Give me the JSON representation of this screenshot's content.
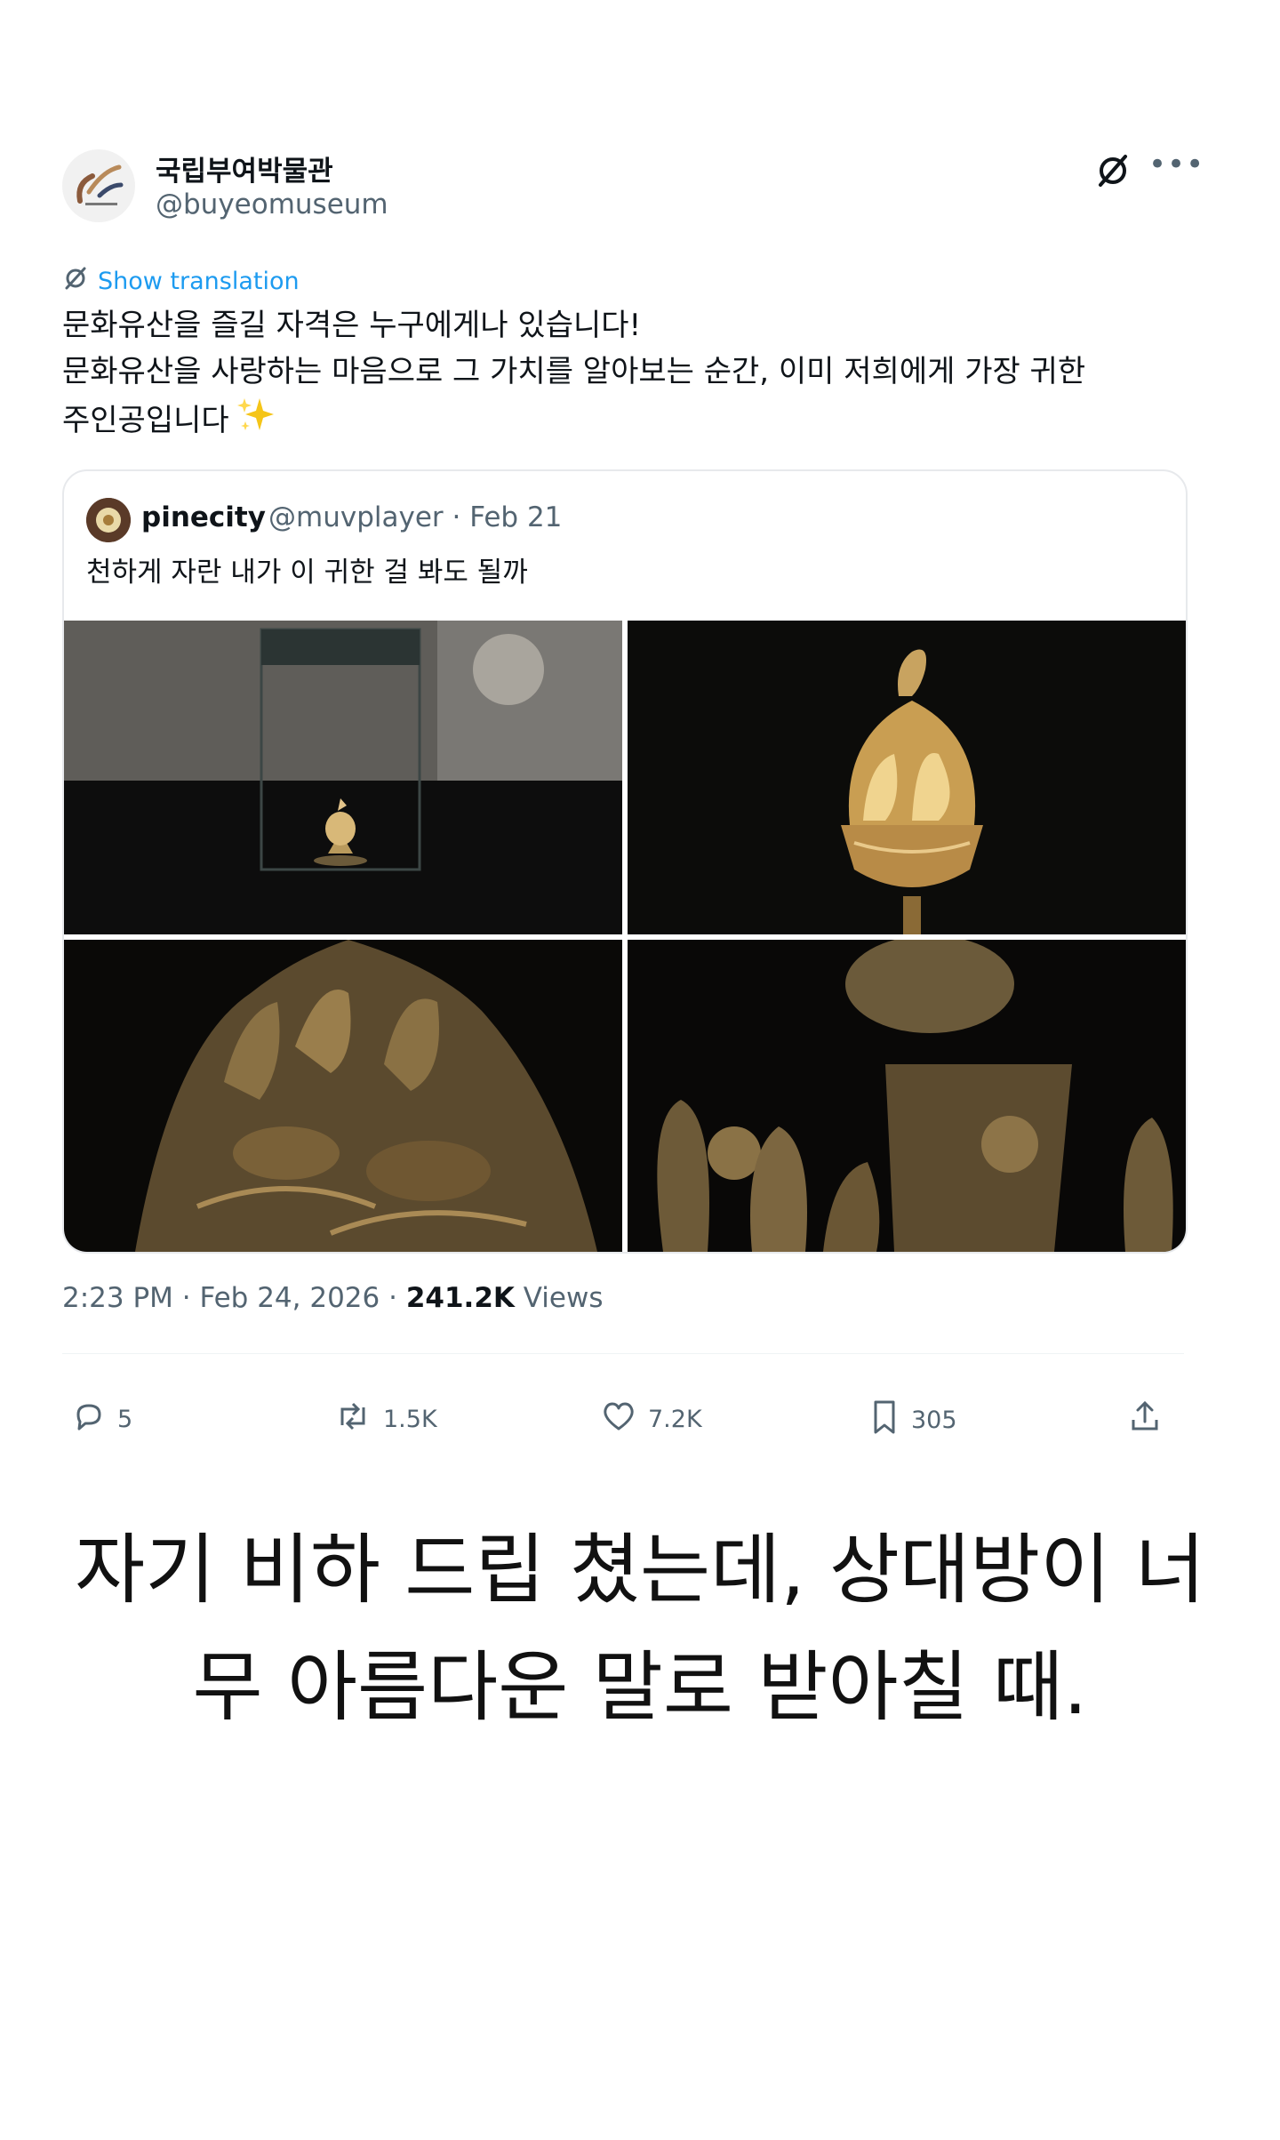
{
  "tweet": {
    "author_name": "국립부여박물관",
    "author_handle": "@buyeomuseum",
    "show_translation": "Show translation",
    "body_lines": [
      "문화유산을 즐길 자격은 누구에게나 있습니다!",
      "문화유산을 사랑하는 마음으로 그 가치를 알아보는 순간, 이미 저희에게 가장 귀한",
      "주인공입니다"
    ],
    "sparkle_icon": "sparkles-emoji",
    "quoted": {
      "name": "pinecity",
      "handle_date": "@muvplayer · Feb 21",
      "text": "천하게 자란 내가 이 귀한 걸 봐도 될까",
      "photos": [
        "incense-burner-in-display-case",
        "incense-burner-closeup",
        "incense-burner-detail-figures",
        "incense-burner-detail-birds"
      ]
    },
    "meta": {
      "time_date": "2:23 PM · Feb 24, 2026 · ",
      "views_count": "241.2K",
      "views_label": " Views"
    },
    "actions": {
      "replies": "5",
      "reposts": "1.5K",
      "likes": "7.2K",
      "bookmarks": "305"
    }
  },
  "caption": {
    "line1": "자기 비하 드립 쳤는데, 상대방이 너",
    "line2": "무 아름다운 말로 받아칠 때."
  },
  "colors": {
    "link": "#1d9bf0",
    "secondary_text": "#536471",
    "border": "#e7e9ec"
  }
}
